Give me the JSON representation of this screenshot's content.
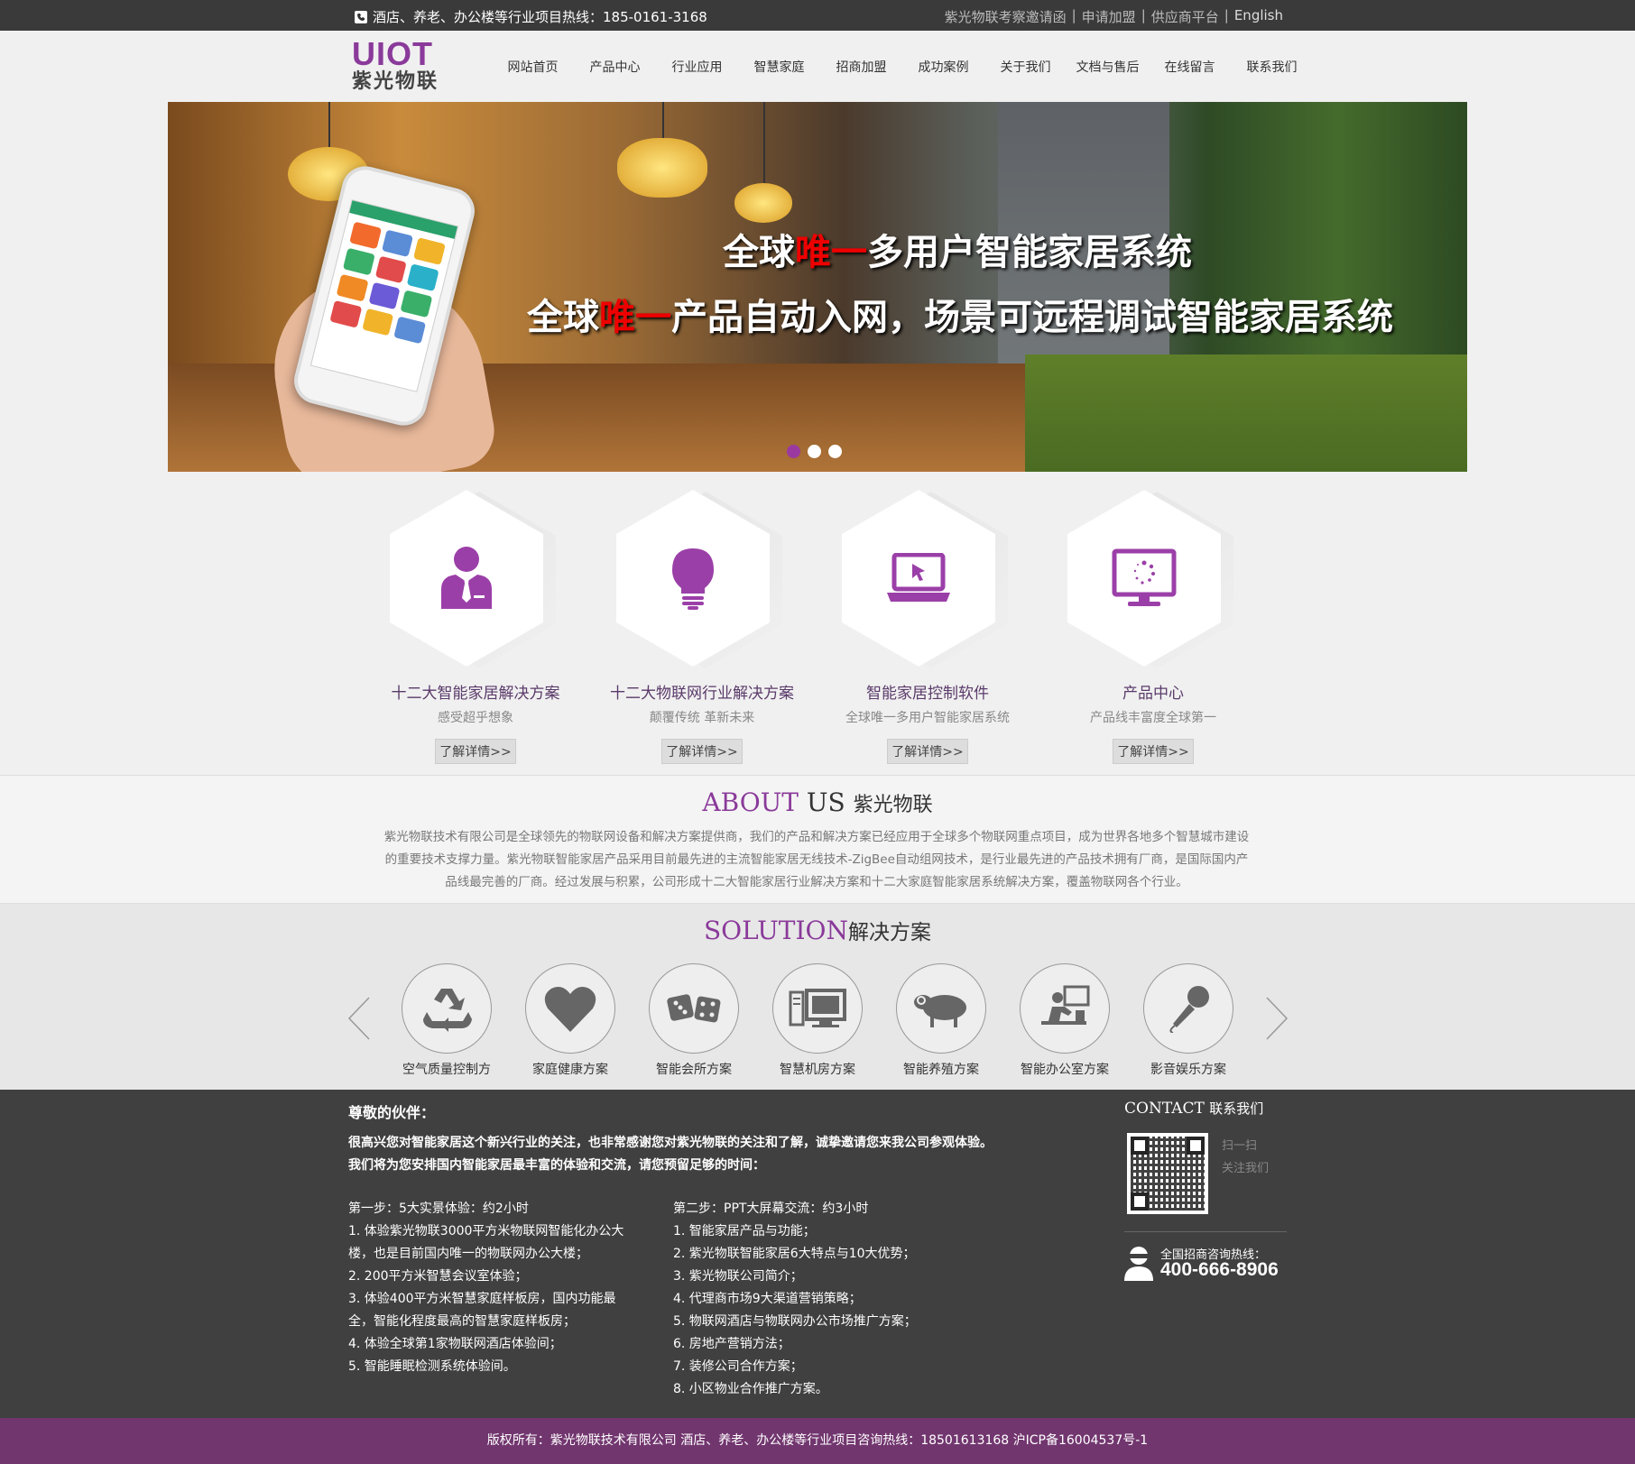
{
  "topbar": {
    "hotline": "酒店、养老、办公楼等行业项目热线：185-0161-3168",
    "links": [
      "紫光物联考察邀请函",
      "申请加盟",
      "供应商平台"
    ],
    "separator": "|",
    "english": "English"
  },
  "logo": {
    "line1": "UIOT",
    "line2": "紫光物联"
  },
  "nav": [
    "网站首页",
    "产品中心",
    "行业应用",
    "智慧家庭",
    "招商加盟",
    "成功案例",
    "关于我们",
    "文档与售后",
    "在线留言",
    "联系我们"
  ],
  "banner": {
    "line1_pre": "全球",
    "line1_red": "唯一",
    "line1_post": "多用户智能家居系统",
    "line2_pre": "全球",
    "line2_red": "唯一",
    "line2_post": "产品自动入网，场景可远程调试智能家居系统",
    "dots_total": 3,
    "dots_active": 1
  },
  "features": [
    {
      "title": "十二大智能家居解决方案",
      "sub": "感受超乎想象",
      "btn": "了解详情>>",
      "icon": "businessman-icon"
    },
    {
      "title": "十二大物联网行业解决方案",
      "sub": "颠覆传统 革新未来",
      "btn": "了解详情>>",
      "icon": "lightbulb-icon"
    },
    {
      "title": "智能家居控制软件",
      "sub": "全球唯一多用户智能家居系统",
      "btn": "了解详情>>",
      "icon": "laptop-icon"
    },
    {
      "title": "产品中心",
      "sub": "产品线丰富度全球第一",
      "btn": "了解详情>>",
      "icon": "monitor-icon"
    }
  ],
  "about": {
    "heading_en": "ABOUT",
    "heading_en2": "US",
    "heading_cn": "紫光物联",
    "text": "紫光物联技术有限公司是全球领先的物联网设备和解决方案提供商，我们的产品和解决方案已经应用于全球多个物联网重点项目，成为世界各地多个智慧城市建设的重要技术支撑力量。紫光物联智能家居产品采用目前最先进的主流智能家居无线技术-ZigBee自动组网技术，是行业最先进的产品技术拥有厂商，是国际国内产品线最完善的厂商。经过发展与积累，公司形成十二大智能家居行业解决方案和十二大家庭智能家居系统解决方案，覆盖物联网各个行业。"
  },
  "solution": {
    "heading_en": "SOLUTION",
    "heading_cn": "解决方案",
    "items": [
      {
        "label": "空气质量控制方",
        "icon": "recycle-icon"
      },
      {
        "label": "家庭健康方案",
        "icon": "heart-icon"
      },
      {
        "label": "智能会所方案",
        "icon": "dice-icon"
      },
      {
        "label": "智慧机房方案",
        "icon": "server-icon"
      },
      {
        "label": "智能养殖方案",
        "icon": "sheep-icon"
      },
      {
        "label": "智能办公室方案",
        "icon": "office-icon"
      },
      {
        "label": "影音娱乐方案",
        "icon": "microphone-icon"
      }
    ]
  },
  "footer": {
    "title": "尊敬的伙伴：",
    "intro1": "很高兴您对智能家居这个新兴行业的关注，也非常感谢您对紫光物联的关注和了解，诚挚邀请您来我公司参观体验。",
    "intro2": "我们将为您安排国内智能家居最丰富的体验和交流，请您预留足够的时间：",
    "col1": [
      "第一步：5大实景体验：约2小时",
      "1. 体验紫光物联3000平方米物联网智能化办公大楼，也是目前国内唯一的物联网办公大楼；",
      "2. 200平方米智慧会议室体验；",
      "3. 体验400平方米智慧家庭样板房，国内功能最全，智能化程度最高的智慧家庭样板房；",
      "4. 体验全球第1家物联网酒店体验间；",
      "5. 智能睡眠检测系统体验间。"
    ],
    "col2": [
      "第二步：PPT大屏幕交流：约3小时",
      "1. 智能家居产品与功能；",
      "2. 紫光物联智能家居6大特点与10大优势；",
      "3. 紫光物联公司简介；",
      "4. 代理商市场9大渠道营销策略；",
      "5. 物联网酒店与物联网办公市场推广方案；",
      "6. 房地产营销方法；",
      "7. 装修公司合作方案；",
      "8. 小区物业合作推广方案。"
    ],
    "contact_en": "CONTACT",
    "contact_cn": "联系我们",
    "scan1": "扫一扫",
    "scan2": "关注我们",
    "hotline_label": "全国招商咨询热线：",
    "hotline_num": "400-666-8906"
  },
  "copyright": "版权所有：紫光物联技术有限公司 酒店、养老、办公楼等行业项目咨询热线：18501613168 沪ICP备16004537号-1",
  "colors": {
    "accent": "#8a3a9a",
    "footer_bg": "#404040",
    "copyright_bg": "#72366f"
  }
}
